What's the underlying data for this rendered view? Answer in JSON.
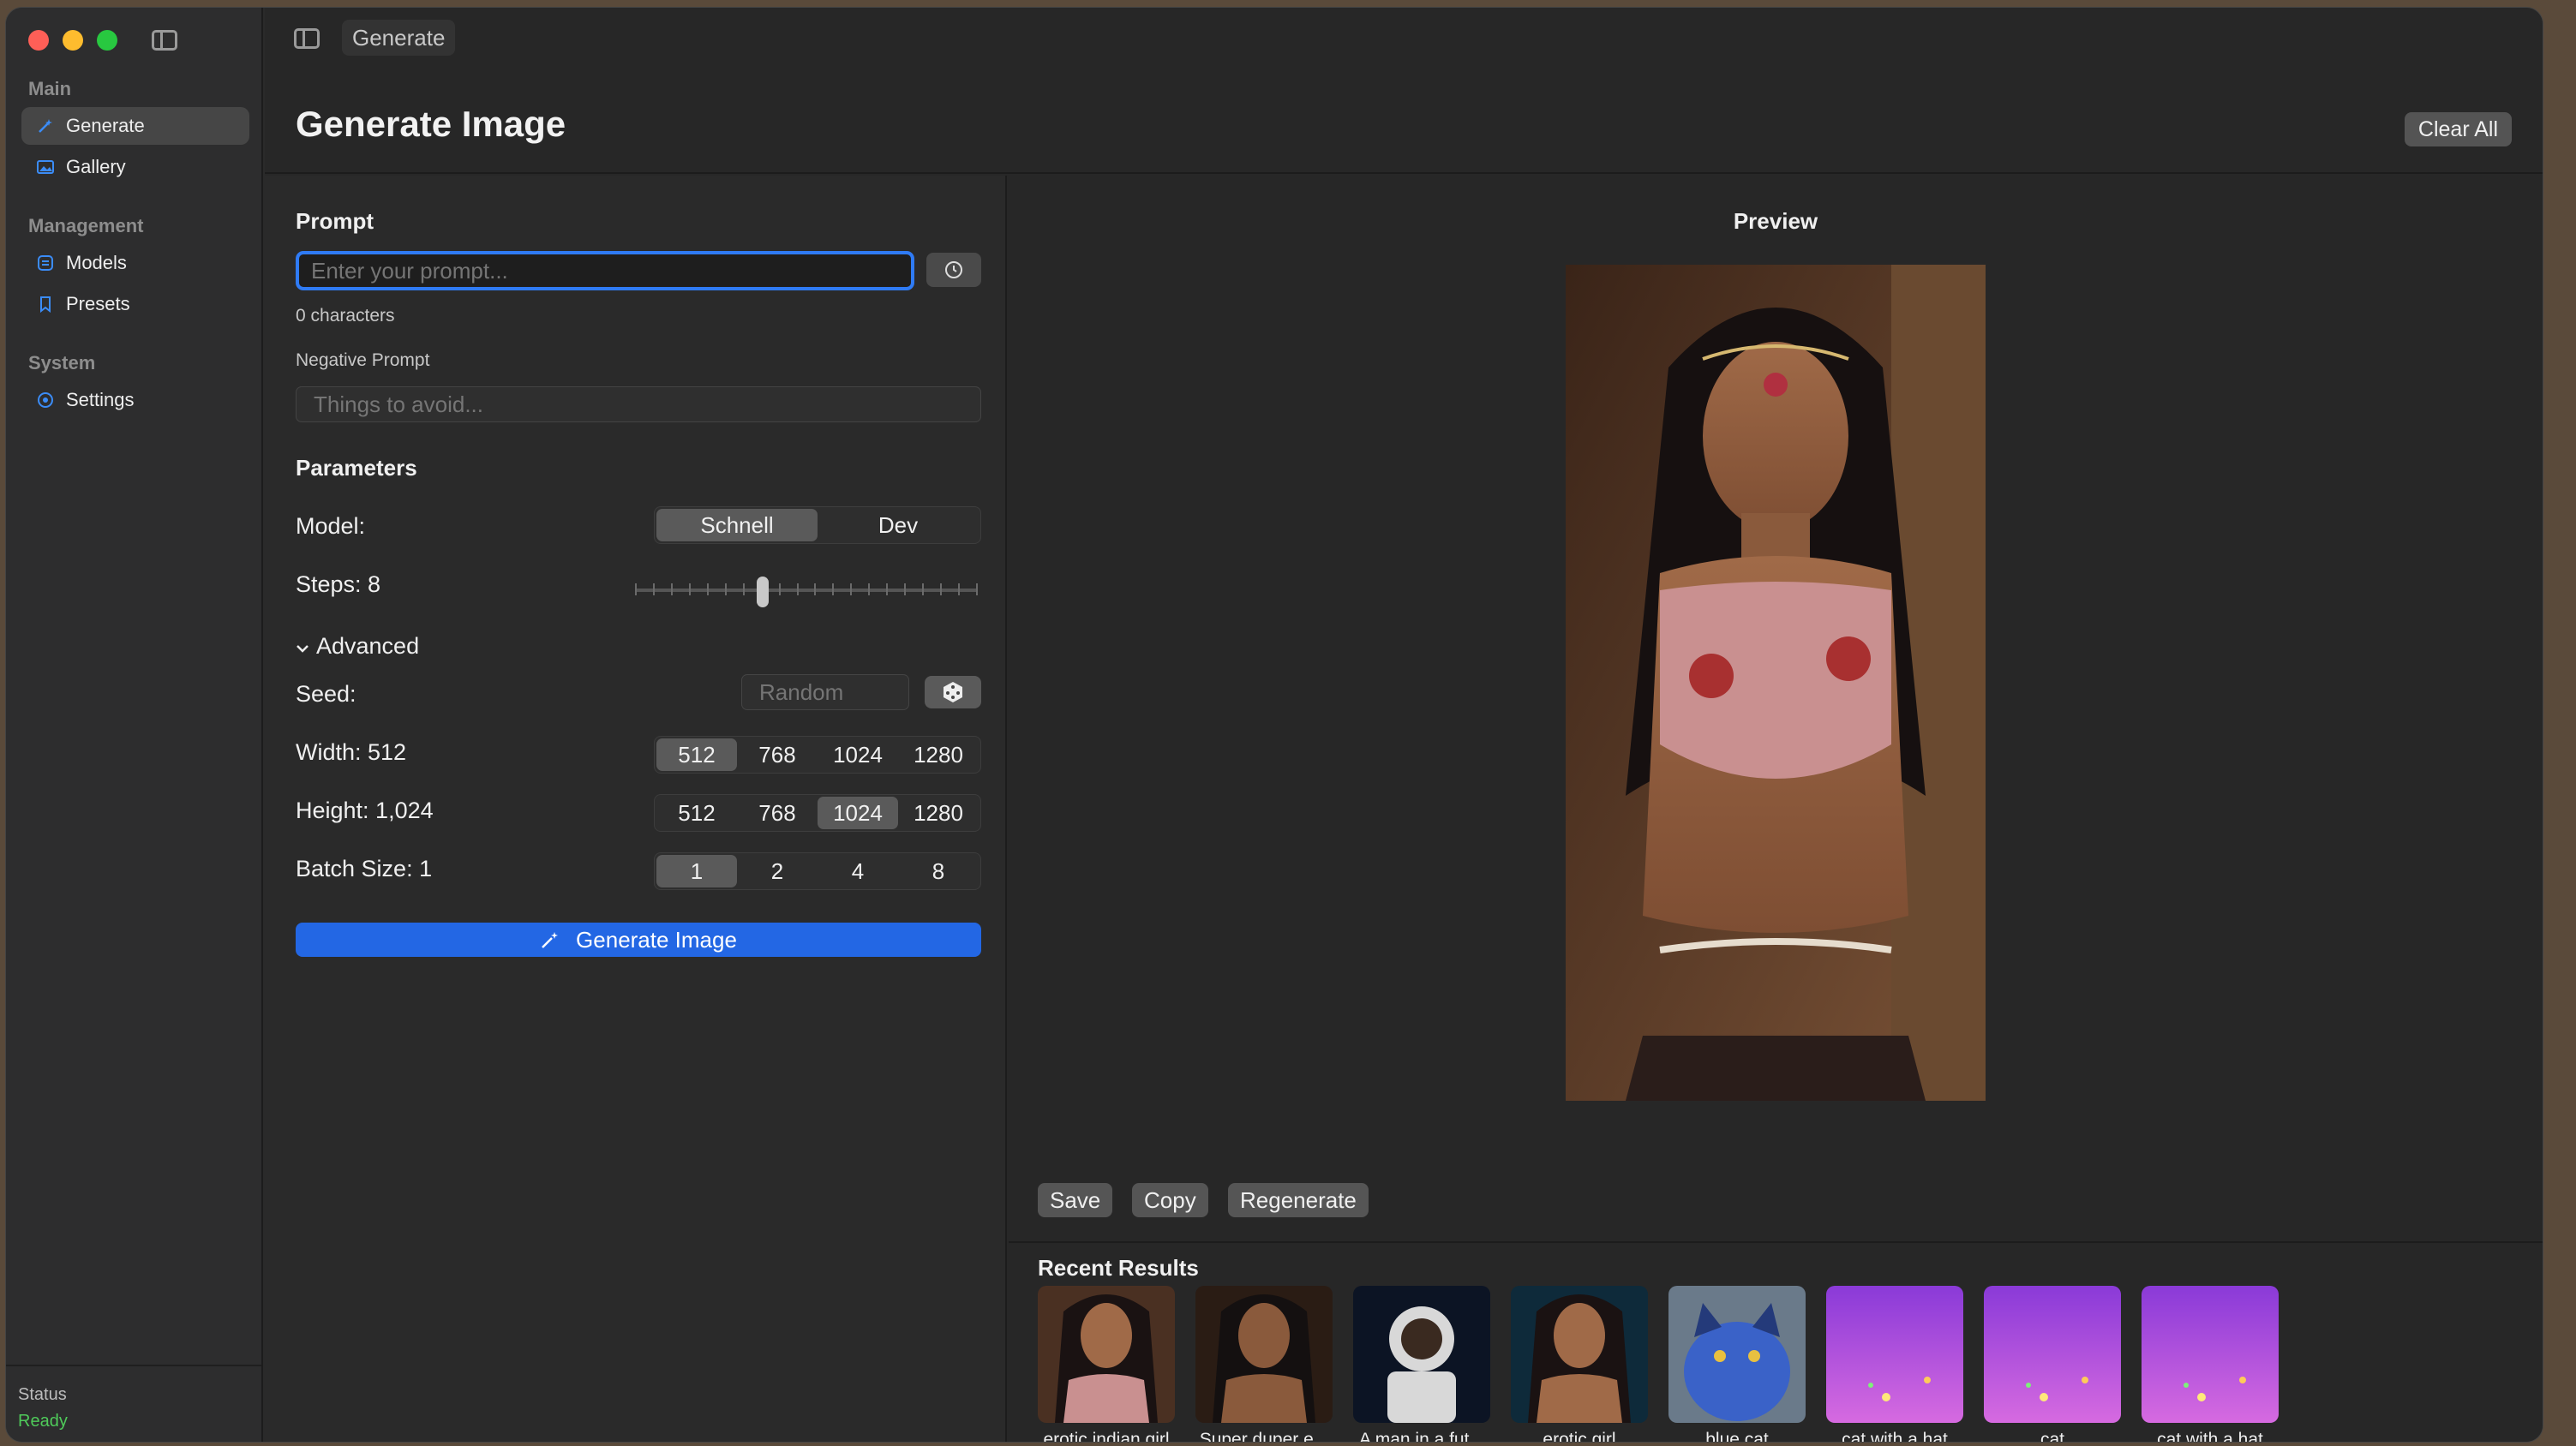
{
  "toolbar": {
    "title": "Generate"
  },
  "sidebar": {
    "sections": [
      {
        "title": "Main",
        "items": [
          {
            "label": "Generate",
            "icon": "wand-icon",
            "active": true
          },
          {
            "label": "Gallery",
            "icon": "photo-icon"
          }
        ]
      },
      {
        "title": "Management",
        "items": [
          {
            "label": "Models",
            "icon": "cube-icon"
          },
          {
            "label": "Presets",
            "icon": "bookmark-icon"
          }
        ]
      },
      {
        "title": "System",
        "items": [
          {
            "label": "Settings",
            "icon": "gear-icon"
          }
        ]
      }
    ],
    "status_label": "Status",
    "status_value": "Ready"
  },
  "header": {
    "title": "Generate Image",
    "clear_label": "Clear All"
  },
  "form": {
    "prompt_heading": "Prompt",
    "prompt_placeholder": "Enter your prompt...",
    "prompt_value": "",
    "char_count": "0 characters",
    "negative_label": "Negative Prompt",
    "negative_placeholder": "Things to avoid...",
    "parameters_heading": "Parameters",
    "model_label": "Model:",
    "model_options": [
      "Schnell",
      "Dev"
    ],
    "model_selected": "Schnell",
    "steps_label": "Steps: 8",
    "steps_value": 8,
    "steps_range": [
      1,
      20
    ],
    "advanced_label": "Advanced",
    "seed_label": "Seed:",
    "seed_placeholder": "Random",
    "width_label": "Width: 512",
    "width_options": [
      "512",
      "768",
      "1024",
      "1280"
    ],
    "width_selected": "512",
    "height_label": "Height: 1,024",
    "height_options": [
      "512",
      "768",
      "1024",
      "1280"
    ],
    "height_selected": "1024",
    "batch_label": "Batch Size: 1",
    "batch_options": [
      "1",
      "2",
      "4",
      "8"
    ],
    "batch_selected": "1",
    "generate_label": "Generate Image"
  },
  "preview": {
    "heading": "Preview",
    "save_label": "Save",
    "copy_label": "Copy",
    "regenerate_label": "Regenerate"
  },
  "recent": {
    "heading": "Recent Results",
    "items": [
      {
        "caption": "erotic indian girl",
        "kind": "portrait-warm"
      },
      {
        "caption": "Super duper e...",
        "kind": "portrait-dark"
      },
      {
        "caption": "A man in a fut...",
        "kind": "astronaut"
      },
      {
        "caption": "erotic girl",
        "kind": "portrait-blue"
      },
      {
        "caption": "blue cat",
        "kind": "blue-cat"
      },
      {
        "caption": "cat with a hat",
        "kind": "purple"
      },
      {
        "caption": "cat",
        "kind": "purple"
      },
      {
        "caption": "cat with a hat",
        "kind": "purple"
      }
    ]
  },
  "colors": {
    "accent": "#2367e4",
    "focus_ring": "#2f7bf5",
    "status_ready": "#4fca5a"
  }
}
